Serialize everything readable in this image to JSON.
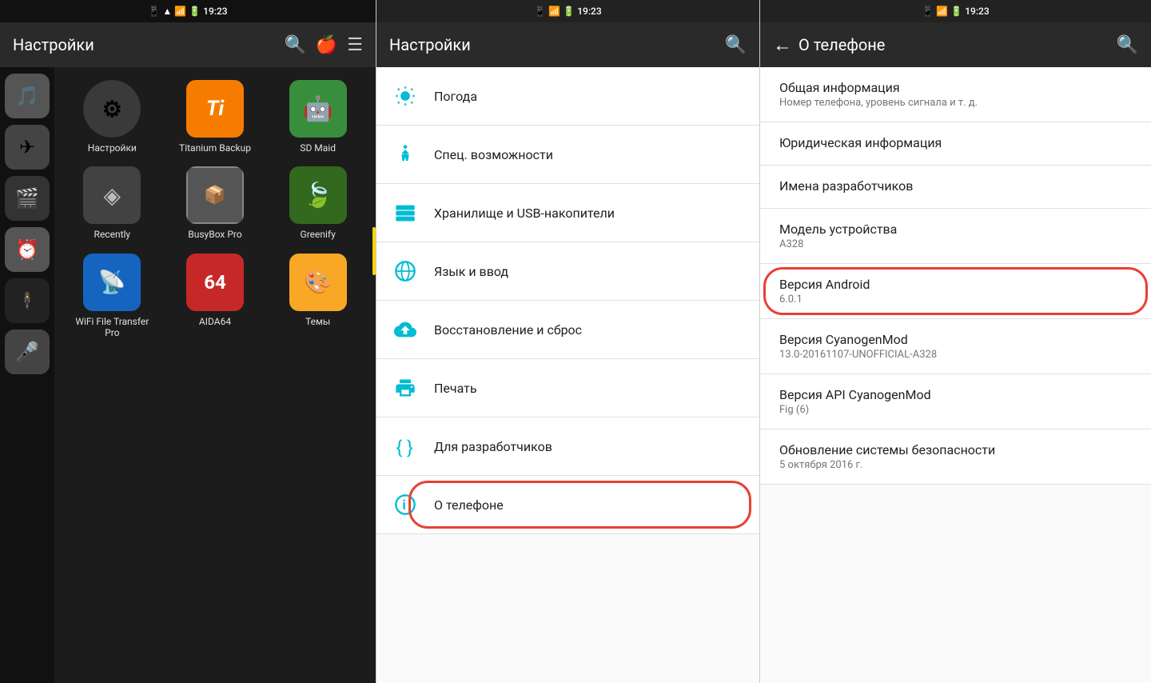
{
  "left": {
    "status_time": "19:23",
    "header_title": "Настройки",
    "apps": [
      {
        "name": "Настройки",
        "bg": "#333",
        "icon": "⚙",
        "selected": true
      },
      {
        "name": "Titanium Backup",
        "bg": "#f57c00",
        "icon": "Ti"
      },
      {
        "name": "SD Maid",
        "bg": "#388e3c",
        "icon": "🤖"
      },
      {
        "name": "Recently",
        "bg": "#424242",
        "icon": "◈"
      },
      {
        "name": "BusyBox Pro",
        "bg": "#555",
        "icon": "📦"
      },
      {
        "name": "Greenify",
        "bg": "#33691e",
        "icon": "🍃"
      },
      {
        "name": "WiFi File Transfer Pro",
        "bg": "#1565c0",
        "icon": "📡"
      },
      {
        "name": "AIDA64",
        "bg": "#c62828",
        "icon": "64"
      },
      {
        "name": "Темы",
        "bg": "#7b1fa2",
        "icon": "🎨"
      }
    ],
    "sidebar_apps": [
      "🎵",
      "✈",
      "🎬",
      "⏰",
      "🎭",
      "🎤"
    ]
  },
  "middle": {
    "status_time": "19:23",
    "header_title": "Настройки",
    "items": [
      {
        "icon": "weather",
        "label": "Погода"
      },
      {
        "icon": "accessibility",
        "label": "Спец. возможности"
      },
      {
        "icon": "storage",
        "label": "Хранилище и USB-накопители"
      },
      {
        "icon": "language",
        "label": "Язык и ввод"
      },
      {
        "icon": "backup",
        "label": "Восстановление и сброс"
      },
      {
        "icon": "print",
        "label": "Печать"
      },
      {
        "icon": "developer",
        "label": "Для разработчиков"
      },
      {
        "icon": "phone",
        "label": "О телефоне",
        "active": true
      }
    ]
  },
  "right": {
    "status_time": "19:23",
    "header_title": "О телефоне",
    "back_label": "←",
    "items": [
      {
        "title": "Общая информация",
        "subtitle": "Номер телефона, уровень сигнала и т. д."
      },
      {
        "title": "Юридическая информация",
        "subtitle": ""
      },
      {
        "title": "Имена разработчиков",
        "subtitle": ""
      },
      {
        "title": "Модель устройства",
        "subtitle": "A328"
      },
      {
        "title": "Версия Android",
        "subtitle": "6.0.1",
        "highlight": true
      },
      {
        "title": "Версия CyanogenMod",
        "subtitle": "13.0-20161107-UNOFFICIAL-A328"
      },
      {
        "title": "Версия API CyanogenMod",
        "subtitle": "Fig (6)"
      },
      {
        "title": "Обновление системы безопасности",
        "subtitle": "5 октября 2016 г."
      }
    ]
  }
}
